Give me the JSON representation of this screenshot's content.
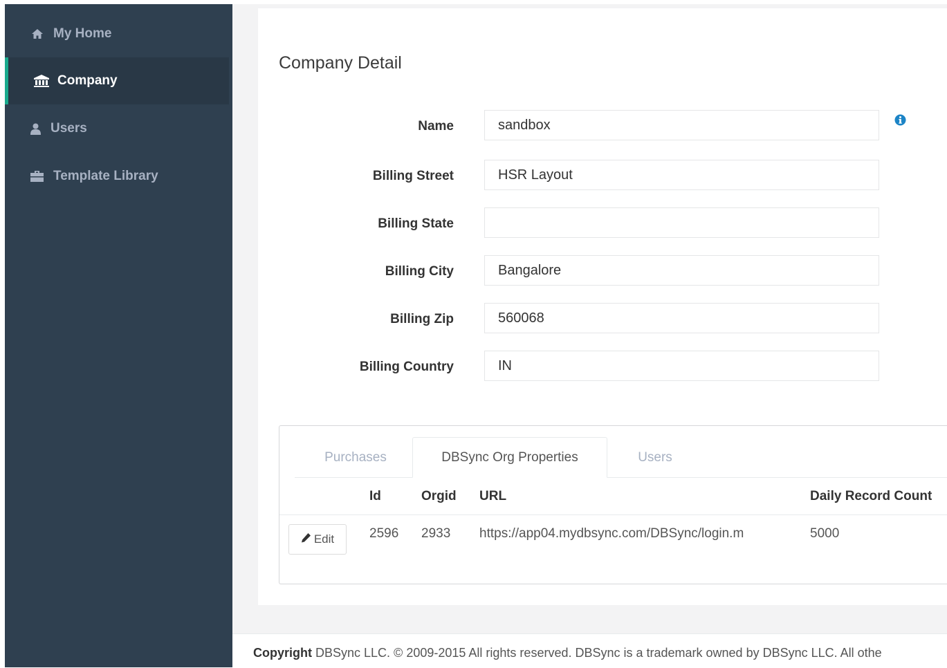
{
  "sidebar": {
    "items": [
      {
        "label": "My Home",
        "icon": "home-icon",
        "active": false
      },
      {
        "label": "Company",
        "icon": "bank-icon",
        "active": true
      },
      {
        "label": "Users",
        "icon": "user-icon",
        "active": false
      },
      {
        "label": "Template Library",
        "icon": "briefcase-icon",
        "active": false
      }
    ],
    "accent_color": "#19aa8d",
    "bg_color": "#2f4050"
  },
  "page": {
    "title": "Company Detail"
  },
  "form": {
    "fields": [
      {
        "label": "Name",
        "value": "sandbox"
      },
      {
        "label": "Billing Street",
        "value": "HSR Layout"
      },
      {
        "label": "Billing State",
        "value": ""
      },
      {
        "label": "Billing City",
        "value": "Bangalore"
      },
      {
        "label": "Billing Zip",
        "value": "560068"
      },
      {
        "label": "Billing Country",
        "value": "IN"
      }
    ],
    "info_icon": "info-circle-icon"
  },
  "tabs": {
    "items": [
      {
        "label": "Purchases",
        "active": false
      },
      {
        "label": "DBSync Org Properties",
        "active": true
      },
      {
        "label": "Users",
        "active": false
      }
    ]
  },
  "table": {
    "headers": [
      "Id",
      "Orgid",
      "URL",
      "Daily Record Count"
    ],
    "rows": [
      {
        "edit_label": "Edit",
        "id": "2596",
        "orgid": "2933",
        "url": "https://app04.mydbsync.com/DBSync/login.m",
        "daily_record_count": "5000"
      }
    ]
  },
  "footer": {
    "copyright_label": "Copyright",
    "text": "DBSync LLC. © 2009-2015 All rights reserved. DBSync is a trademark owned by DBSync LLC. All othe"
  }
}
